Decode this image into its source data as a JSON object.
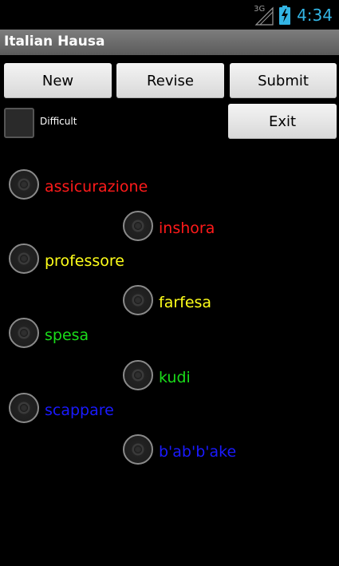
{
  "status_bar": {
    "network_label": "3G",
    "signal_icon": "signal-icon",
    "battery_icon": "battery-charging-icon",
    "time": "4:34",
    "time_color": "#33b5e5"
  },
  "app": {
    "title": "Italian Hausa"
  },
  "buttons": {
    "new_label": "New",
    "revise_label": "Revise",
    "submit_label": "Submit",
    "exit_label": "Exit"
  },
  "difficult": {
    "label": "Difficult",
    "checked": false
  },
  "pairs": [
    {
      "italian": "assicurazione",
      "hausa": "inshora",
      "color": "#ff1a1a"
    },
    {
      "italian": "professore",
      "hausa": "farfesa",
      "color": "#ffff1a"
    },
    {
      "italian": "spesa",
      "hausa": "kudi",
      "color": "#1adc1a"
    },
    {
      "italian": "scappare",
      "hausa": "b'ab'b'ake",
      "color": "#1a1aff"
    }
  ]
}
